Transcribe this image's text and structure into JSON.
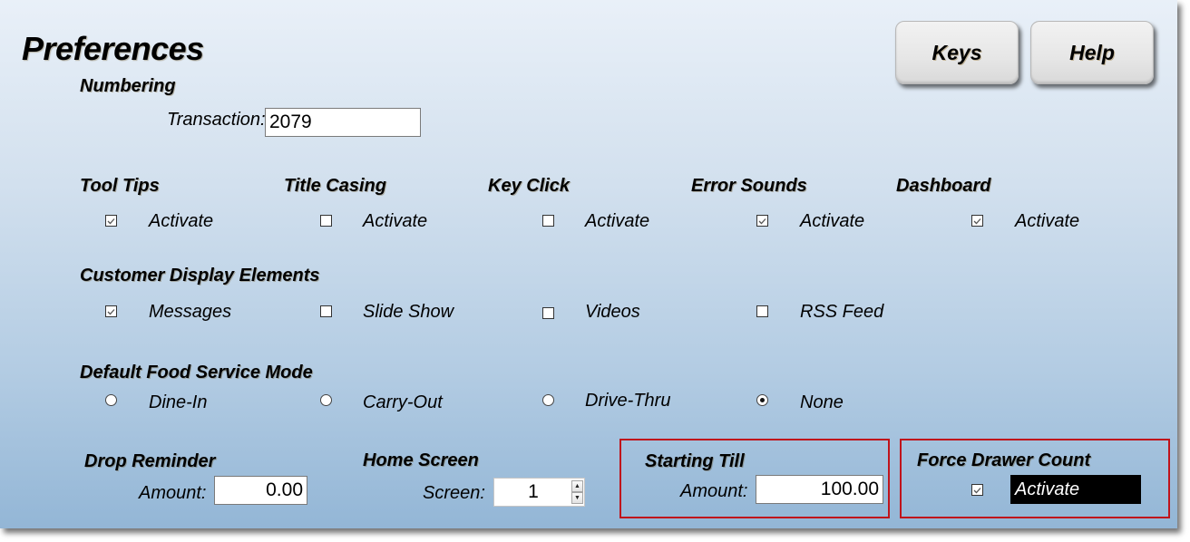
{
  "page": {
    "title": "Preferences"
  },
  "header_buttons": {
    "keys_label": "Keys",
    "help_label": "Help"
  },
  "numbering": {
    "heading": "Numbering",
    "transaction_label": "Transaction:",
    "transaction_value": "2079"
  },
  "toggles": [
    {
      "heading": "Tool Tips",
      "label": "Activate",
      "checked": true
    },
    {
      "heading": "Title Casing",
      "label": "Activate",
      "checked": false
    },
    {
      "heading": "Key Click",
      "label": "Activate",
      "checked": false
    },
    {
      "heading": "Error Sounds",
      "label": "Activate",
      "checked": true
    },
    {
      "heading": "Dashboard",
      "label": "Activate",
      "checked": true
    }
  ],
  "customer_display": {
    "heading": "Customer Display Elements",
    "items": [
      {
        "label": "Messages",
        "checked": true
      },
      {
        "label": "Slide Show",
        "checked": false
      },
      {
        "label": "Videos",
        "checked": false
      },
      {
        "label": "RSS Feed",
        "checked": false
      }
    ]
  },
  "food_service_mode": {
    "heading": "Default Food Service Mode",
    "options": [
      {
        "label": "Dine-In",
        "selected": false
      },
      {
        "label": "Carry-Out",
        "selected": false
      },
      {
        "label": "Drive-Thru",
        "selected": false
      },
      {
        "label": "None",
        "selected": true
      }
    ]
  },
  "drop_reminder": {
    "heading": "Drop Reminder",
    "amount_label": "Amount:",
    "amount_value": "0.00"
  },
  "home_screen": {
    "heading": "Home Screen",
    "screen_label": "Screen:",
    "screen_value": "1",
    "up_icon": "▲",
    "down_icon": "▼"
  },
  "starting_till": {
    "heading": "Starting Till",
    "amount_label": "Amount:",
    "amount_value": "100.00"
  },
  "force_drawer_count": {
    "heading": "Force Drawer Count",
    "label": "Activate",
    "checked": true
  },
  "colors": {
    "highlight_border": "#c0131b",
    "panel_top": "#e9f0f8",
    "panel_bottom": "#93b6d6"
  }
}
